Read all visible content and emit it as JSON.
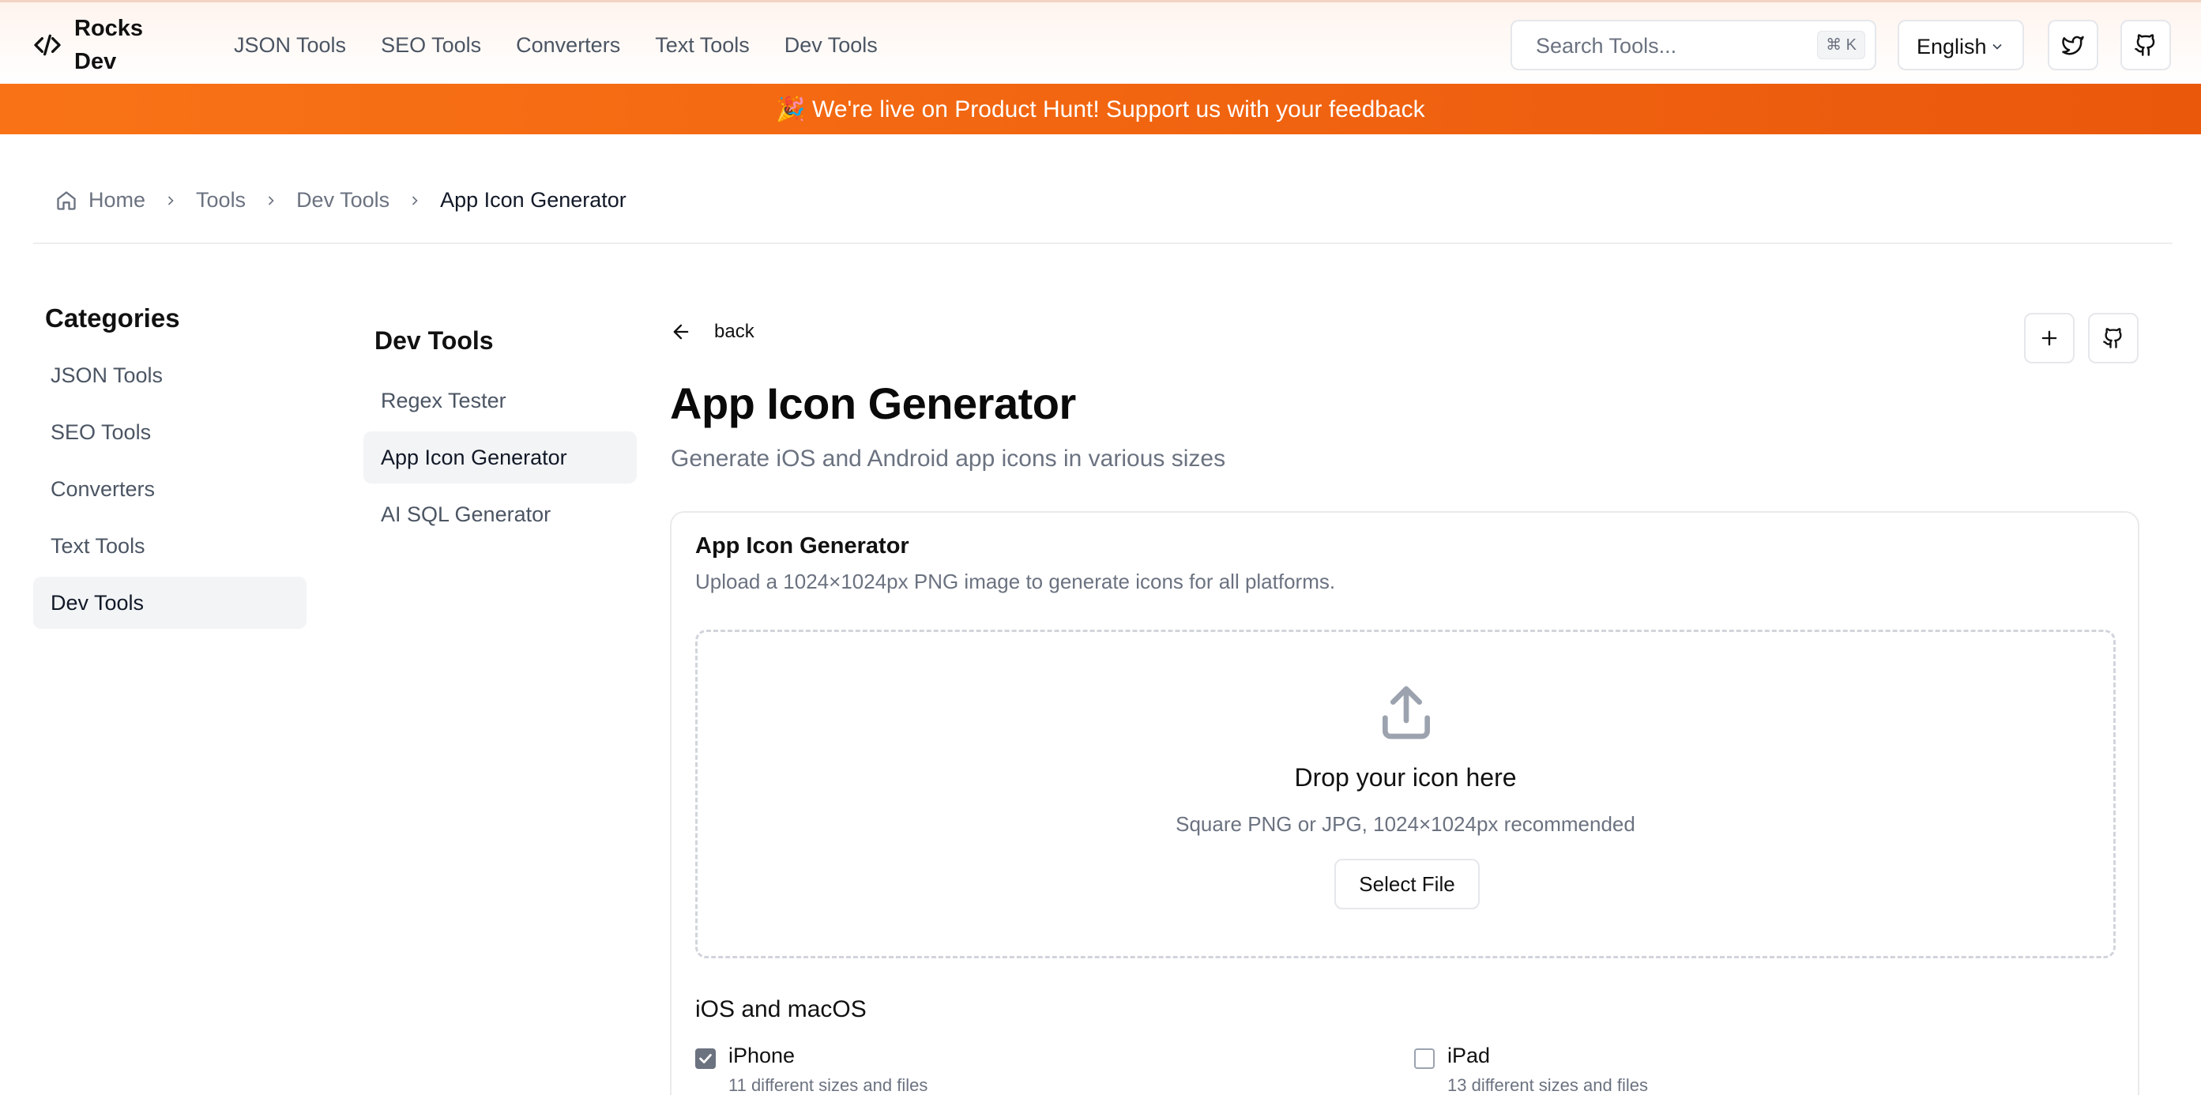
{
  "header": {
    "logo_text": "Rocks Dev",
    "nav": [
      "JSON Tools",
      "SEO Tools",
      "Converters",
      "Text Tools",
      "Dev Tools"
    ],
    "search_placeholder": "Search Tools...",
    "search_shortcut": "⌘ K",
    "language": "English"
  },
  "banner": {
    "text": "🎉 We're live on Product Hunt! Support us with your feedback"
  },
  "breadcrumb": [
    "Home",
    "Tools",
    "Dev Tools",
    "App Icon Generator"
  ],
  "categories": {
    "title": "Categories",
    "items": [
      "JSON Tools",
      "SEO Tools",
      "Converters",
      "Text Tools",
      "Dev Tools"
    ],
    "active": "Dev Tools"
  },
  "subnav": {
    "title": "Dev Tools",
    "items": [
      "Regex Tester",
      "App Icon Generator",
      "AI SQL Generator"
    ],
    "active": "App Icon Generator"
  },
  "main": {
    "back_label": "back",
    "title": "App Icon Generator",
    "subtitle": "Generate iOS and Android app icons in various sizes",
    "card": {
      "title": "App Icon Generator",
      "description": "Upload a 1024×1024px PNG image to generate icons for all platforms.",
      "dropzone": {
        "title": "Drop your icon here",
        "hint": "Square PNG or JPG, 1024×1024px recommended",
        "button": "Select File"
      },
      "section_title": "iOS and macOS",
      "options": [
        {
          "label": "iPhone",
          "detail": "11 different sizes and files",
          "checked": true
        },
        {
          "label": "iPad",
          "detail": "13 different sizes and files",
          "checked": false
        }
      ]
    }
  },
  "colors": {
    "banner_start": "#f97316",
    "banner_end": "#ea580c",
    "checkbox_checked": "#6b7280"
  }
}
